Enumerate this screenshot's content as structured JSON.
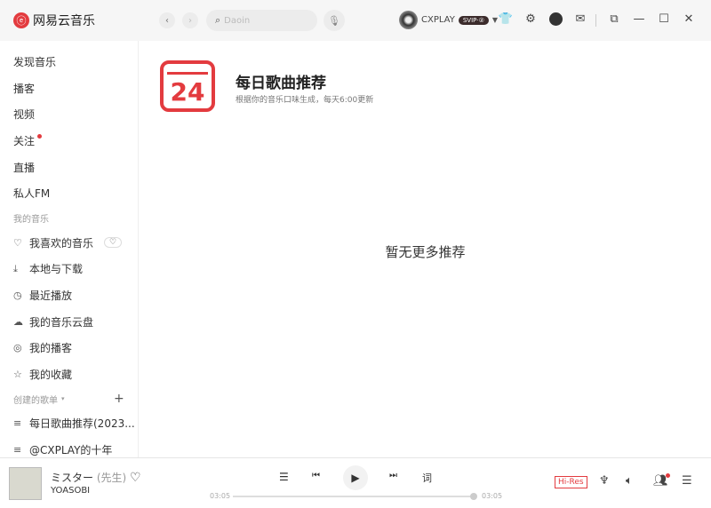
{
  "app": {
    "name": "网易云音乐"
  },
  "header": {
    "search_placeholder": "Daoin",
    "user": "CXPLAY",
    "vip_badge": "SVIP·②"
  },
  "sidebar": {
    "top_items": [
      {
        "label": "发现音乐"
      },
      {
        "label": "播客"
      },
      {
        "label": "视频"
      },
      {
        "label": "关注",
        "badge": true
      },
      {
        "label": "直播"
      },
      {
        "label": "私人FM"
      }
    ],
    "my_music_header": "我的音乐",
    "my_music": [
      {
        "label": "我喜欢的音乐",
        "icon": "heart-icon"
      },
      {
        "label": "本地与下载",
        "icon": "download-icon"
      },
      {
        "label": "最近播放",
        "icon": "clock-icon"
      },
      {
        "label": "我的音乐云盘",
        "icon": "cloud-icon"
      },
      {
        "label": "我的播客",
        "icon": "podcast-icon"
      },
      {
        "label": "我的收藏",
        "icon": "star-user-icon"
      }
    ],
    "created_header": "创建的歌单",
    "playlists": [
      {
        "label": "每日歌曲推荐(2023..."
      },
      {
        "label": "@CXPLAY的十年"
      }
    ]
  },
  "main": {
    "calendar_day": "24",
    "title": "每日歌曲推荐",
    "subtitle": "根据你的音乐口味生成，每天6:00更新",
    "empty": "暂无更多推荐"
  },
  "player": {
    "title": "ミスター",
    "title_alt": "(先生)",
    "artist": "YOASOBI",
    "elapsed": "03:05",
    "duration": "03:05",
    "progress": 1.0,
    "lyrics": "词",
    "quality": "Hi-Res"
  },
  "colors": {
    "accent": "#e33b3f"
  }
}
